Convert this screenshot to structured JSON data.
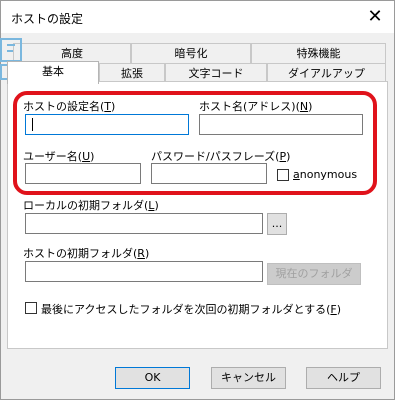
{
  "window": {
    "title": "ホストの設定",
    "close_glyph": "✕"
  },
  "tabs": {
    "row_top": [
      "高度",
      "暗号化",
      "特殊機能"
    ],
    "row_bottom": [
      "基本",
      "拡張",
      "文字コード",
      "ダイアルアップ"
    ],
    "active": "基本"
  },
  "fields": {
    "host_name_label": "ホストの設定名(",
    "host_name_key": "T",
    "host_address_label": "ホスト名(アドレス)(",
    "host_address_key": "N",
    "user_label": "ユーザー名(",
    "user_key": "U",
    "password_label": "パスワード/パスフレーズ(",
    "password_key": "P",
    "anonymous_label": "anonymous",
    "anonymous_key": "a",
    "local_folder_label": "ローカルの初期フォルダ(",
    "local_folder_key": "L",
    "host_folder_label": "ホストの初期フォルダ(",
    "host_folder_key": "R",
    "browse_label": "...",
    "current_folder_label": "現在のフォルダ",
    "last_folder_label": "最後にアクセスしたフォルダを次回の初期フォルダとする(",
    "last_folder_key": "F"
  },
  "buttons": {
    "ok": "OK",
    "cancel": "キャンセル",
    "help": "ヘルプ"
  },
  "colors": {
    "highlight": "#e0121b",
    "focus": "#0078d7"
  }
}
